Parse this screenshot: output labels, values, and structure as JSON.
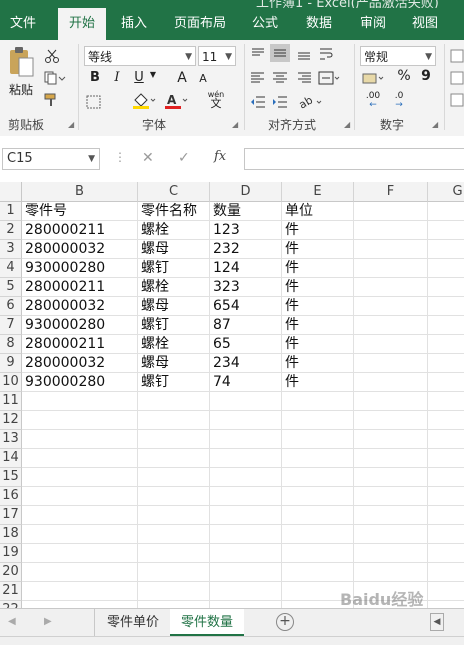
{
  "window": {
    "title": "工作簿1 - Excel(产品激活失败)"
  },
  "ribbon_tabs": [
    "文件",
    "开始",
    "插入",
    "页面布局",
    "公式",
    "数据",
    "审阅",
    "视图"
  ],
  "active_tab": "开始",
  "ribbon": {
    "paste_label": "粘贴",
    "clipboard_label": "剪贴板",
    "font_label": "字体",
    "alignment_label": "对齐方式",
    "number_label": "数字",
    "font_name": "等线",
    "font_size": "11",
    "number_format": "常规",
    "bold": "B",
    "italic": "I",
    "underline": "U",
    "grow_font": "A",
    "shrink_font": "A",
    "percent": "%",
    "comma": "9",
    "wen": "wén",
    "wen_char": "文",
    "dec_inc": ".00",
    "dec_dec": ".0"
  },
  "formula_bar": {
    "name_box": "C15",
    "fx": "fx",
    "cancel": "✕",
    "enter": "✓"
  },
  "columns": [
    "B",
    "C",
    "D",
    "E",
    "F",
    "G"
  ],
  "rows": [
    "1",
    "2",
    "3",
    "4",
    "5",
    "6",
    "7",
    "8",
    "9",
    "10",
    "11",
    "12",
    "13",
    "14",
    "15",
    "16",
    "17",
    "18",
    "19",
    "20",
    "21",
    "22"
  ],
  "table": [
    [
      "零件号",
      "零件名称",
      "数量",
      "单位"
    ],
    [
      "280000211",
      "螺栓",
      "123",
      "件"
    ],
    [
      "280000032",
      "螺母",
      "232",
      "件"
    ],
    [
      "930000280",
      "螺钉",
      "124",
      "件"
    ],
    [
      "280000211",
      "螺栓",
      "323",
      "件"
    ],
    [
      "280000032",
      "螺母",
      "654",
      "件"
    ],
    [
      "930000280",
      "螺钉",
      "87",
      "件"
    ],
    [
      "280000211",
      "螺栓",
      "65",
      "件"
    ],
    [
      "280000032",
      "螺母",
      "234",
      "件"
    ],
    [
      "930000280",
      "螺钉",
      "74",
      "件"
    ]
  ],
  "sheet_tabs": [
    "零件单价",
    "零件数量"
  ],
  "active_sheet": "零件数量",
  "watermark": "Baidu经验",
  "colors": {
    "accent": "#217346"
  }
}
